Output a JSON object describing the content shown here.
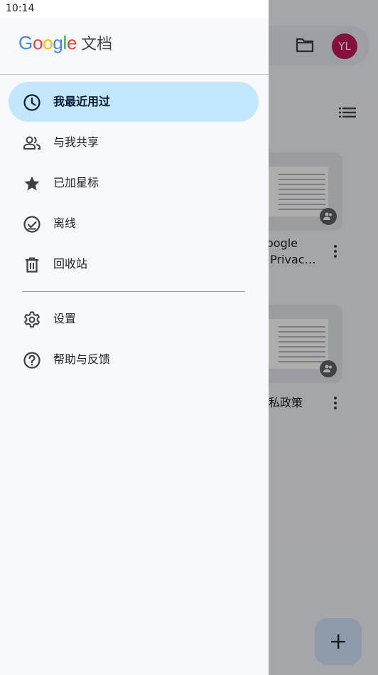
{
  "status_bar": {
    "time": "10:14"
  },
  "app": {
    "avatar_initials": "YL",
    "documents": [
      {
        "title": "oogle\n Privac…"
      },
      {
        "title": "私政策"
      }
    ]
  },
  "drawer": {
    "brand": {
      "logo_letters": [
        "G",
        "o",
        "o",
        "g",
        "l",
        "e"
      ],
      "logo_colors": [
        "#4285F4",
        "#EA4335",
        "#FBBC05",
        "#4285F4",
        "#34A853",
        "#EA4335"
      ],
      "product": "文档"
    },
    "items": [
      {
        "label": "我最近用过",
        "icon": "clock-icon",
        "active": true
      },
      {
        "label": "与我共享",
        "icon": "people-icon",
        "active": false
      },
      {
        "label": "已加星标",
        "icon": "star-icon",
        "active": false
      },
      {
        "label": "离线",
        "icon": "offline-check-icon",
        "active": false
      },
      {
        "label": "回收站",
        "icon": "trash-icon",
        "active": false
      }
    ],
    "secondary_items": [
      {
        "label": "设置",
        "icon": "gear-icon"
      },
      {
        "label": "帮助与反馈",
        "icon": "help-icon"
      }
    ]
  },
  "colors": {
    "active_pill": "#c2e7ff",
    "drawer_bg": "#f8f9fd",
    "avatar_bg": "#c2185b",
    "fab_bg": "#d3e3fd"
  }
}
